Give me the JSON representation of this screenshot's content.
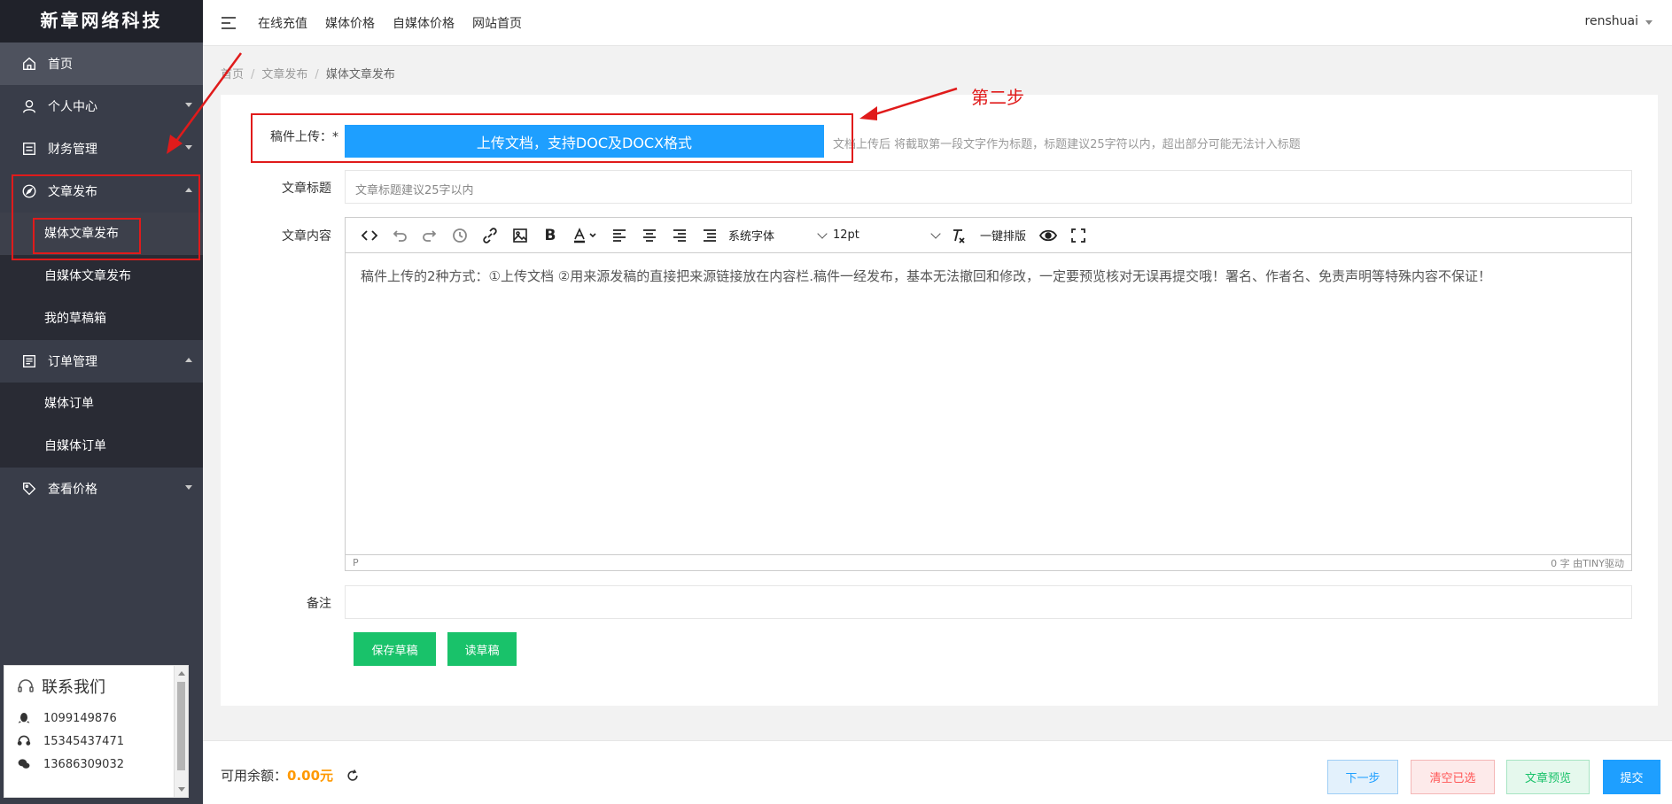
{
  "app": {
    "logo": "新章网络科技",
    "user": "renshuai"
  },
  "sidebar": {
    "items": [
      {
        "label": "首页",
        "icon": "home-icon"
      },
      {
        "label": "个人中心",
        "icon": "user-icon"
      },
      {
        "label": "财务管理",
        "icon": "finance-icon"
      },
      {
        "label": "文章发布",
        "icon": "compass-icon"
      },
      {
        "label": "订单管理",
        "icon": "list-icon"
      },
      {
        "label": "查看价格",
        "icon": "tag-icon"
      }
    ],
    "article_sub": [
      "媒体文章发布",
      "自媒体文章发布",
      "我的草稿箱"
    ],
    "order_sub": [
      "媒体订单",
      "自媒体订单"
    ]
  },
  "header": {
    "nav": [
      "在线充值",
      "媒体价格",
      "自媒体价格",
      "网站首页"
    ]
  },
  "breadcrumb": {
    "home": "首页",
    "section": "文章发布",
    "current": "媒体文章发布"
  },
  "form": {
    "upload_label": "稿件上传：*",
    "upload_button": "上传文档，支持DOC及DOCX格式",
    "upload_hint": "文档上传后 将截取第一段文字作为标题，标题建议25字符以内，超出部分可能无法计入标题",
    "title_label": "文章标题",
    "title_placeholder": "文章标题建议25字以内",
    "content_label": "文章内容",
    "font_family": "系统字体",
    "font_size": "12pt",
    "one_click": "一键排版",
    "content_text": "稿件上传的2种方式：①上传文档 ②用来源发稿的直接把来源链接放在内容栏.稿件一经发布，基本无法撤回和修改，一定要预览核对无误再提交哦！署名、作者名、免责声明等特殊内容不保证！",
    "status_path": "P",
    "status_count": "0 字  由TINY驱动",
    "remark_label": "备注",
    "save_draft": "保存草稿",
    "read_draft": "读草稿"
  },
  "annotation": {
    "step2": "第二步"
  },
  "contact": {
    "title": "联系我们",
    "qq": "1099149876",
    "phone": "15345437471",
    "wechat": "13686309032"
  },
  "footer": {
    "balance_label": "可用余额：",
    "balance_value": "0.00元",
    "next": "下一步",
    "clear": "清空已选",
    "preview": "文章预览",
    "submit": "提交"
  }
}
